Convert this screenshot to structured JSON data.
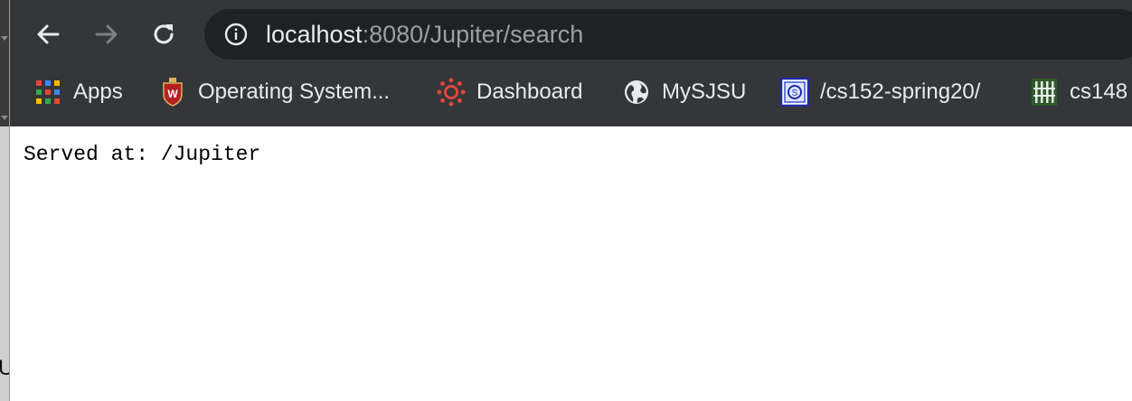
{
  "browser": {
    "url_host": "localhost",
    "url_rest": ":8080/Jupiter/search",
    "icons": {
      "back": "back-arrow-icon",
      "forward": "forward-arrow-icon",
      "reload": "reload-icon",
      "site_info": "info-icon"
    }
  },
  "bookmarks": [
    {
      "label": "Apps",
      "icon": "apps-grid-icon"
    },
    {
      "label": "Operating System...",
      "icon": "university-crest-icon"
    },
    {
      "label": "Dashboard",
      "icon": "canvas-logo-icon"
    },
    {
      "label": "MySJSU",
      "icon": "globe-icon"
    },
    {
      "label": "/cs152-spring20/",
      "icon": "blue-square-site-icon"
    },
    {
      "label": "cs148",
      "icon": "green-grid-site-icon"
    }
  ],
  "page": {
    "served_text": "Served at: /Jupiter"
  },
  "colors": {
    "toolbar_bg": "#35363a",
    "omnibox_bg": "#202124",
    "url_host": "#e8eaed",
    "url_rest": "#9aa0a6",
    "page_bg": "#ffffff"
  }
}
